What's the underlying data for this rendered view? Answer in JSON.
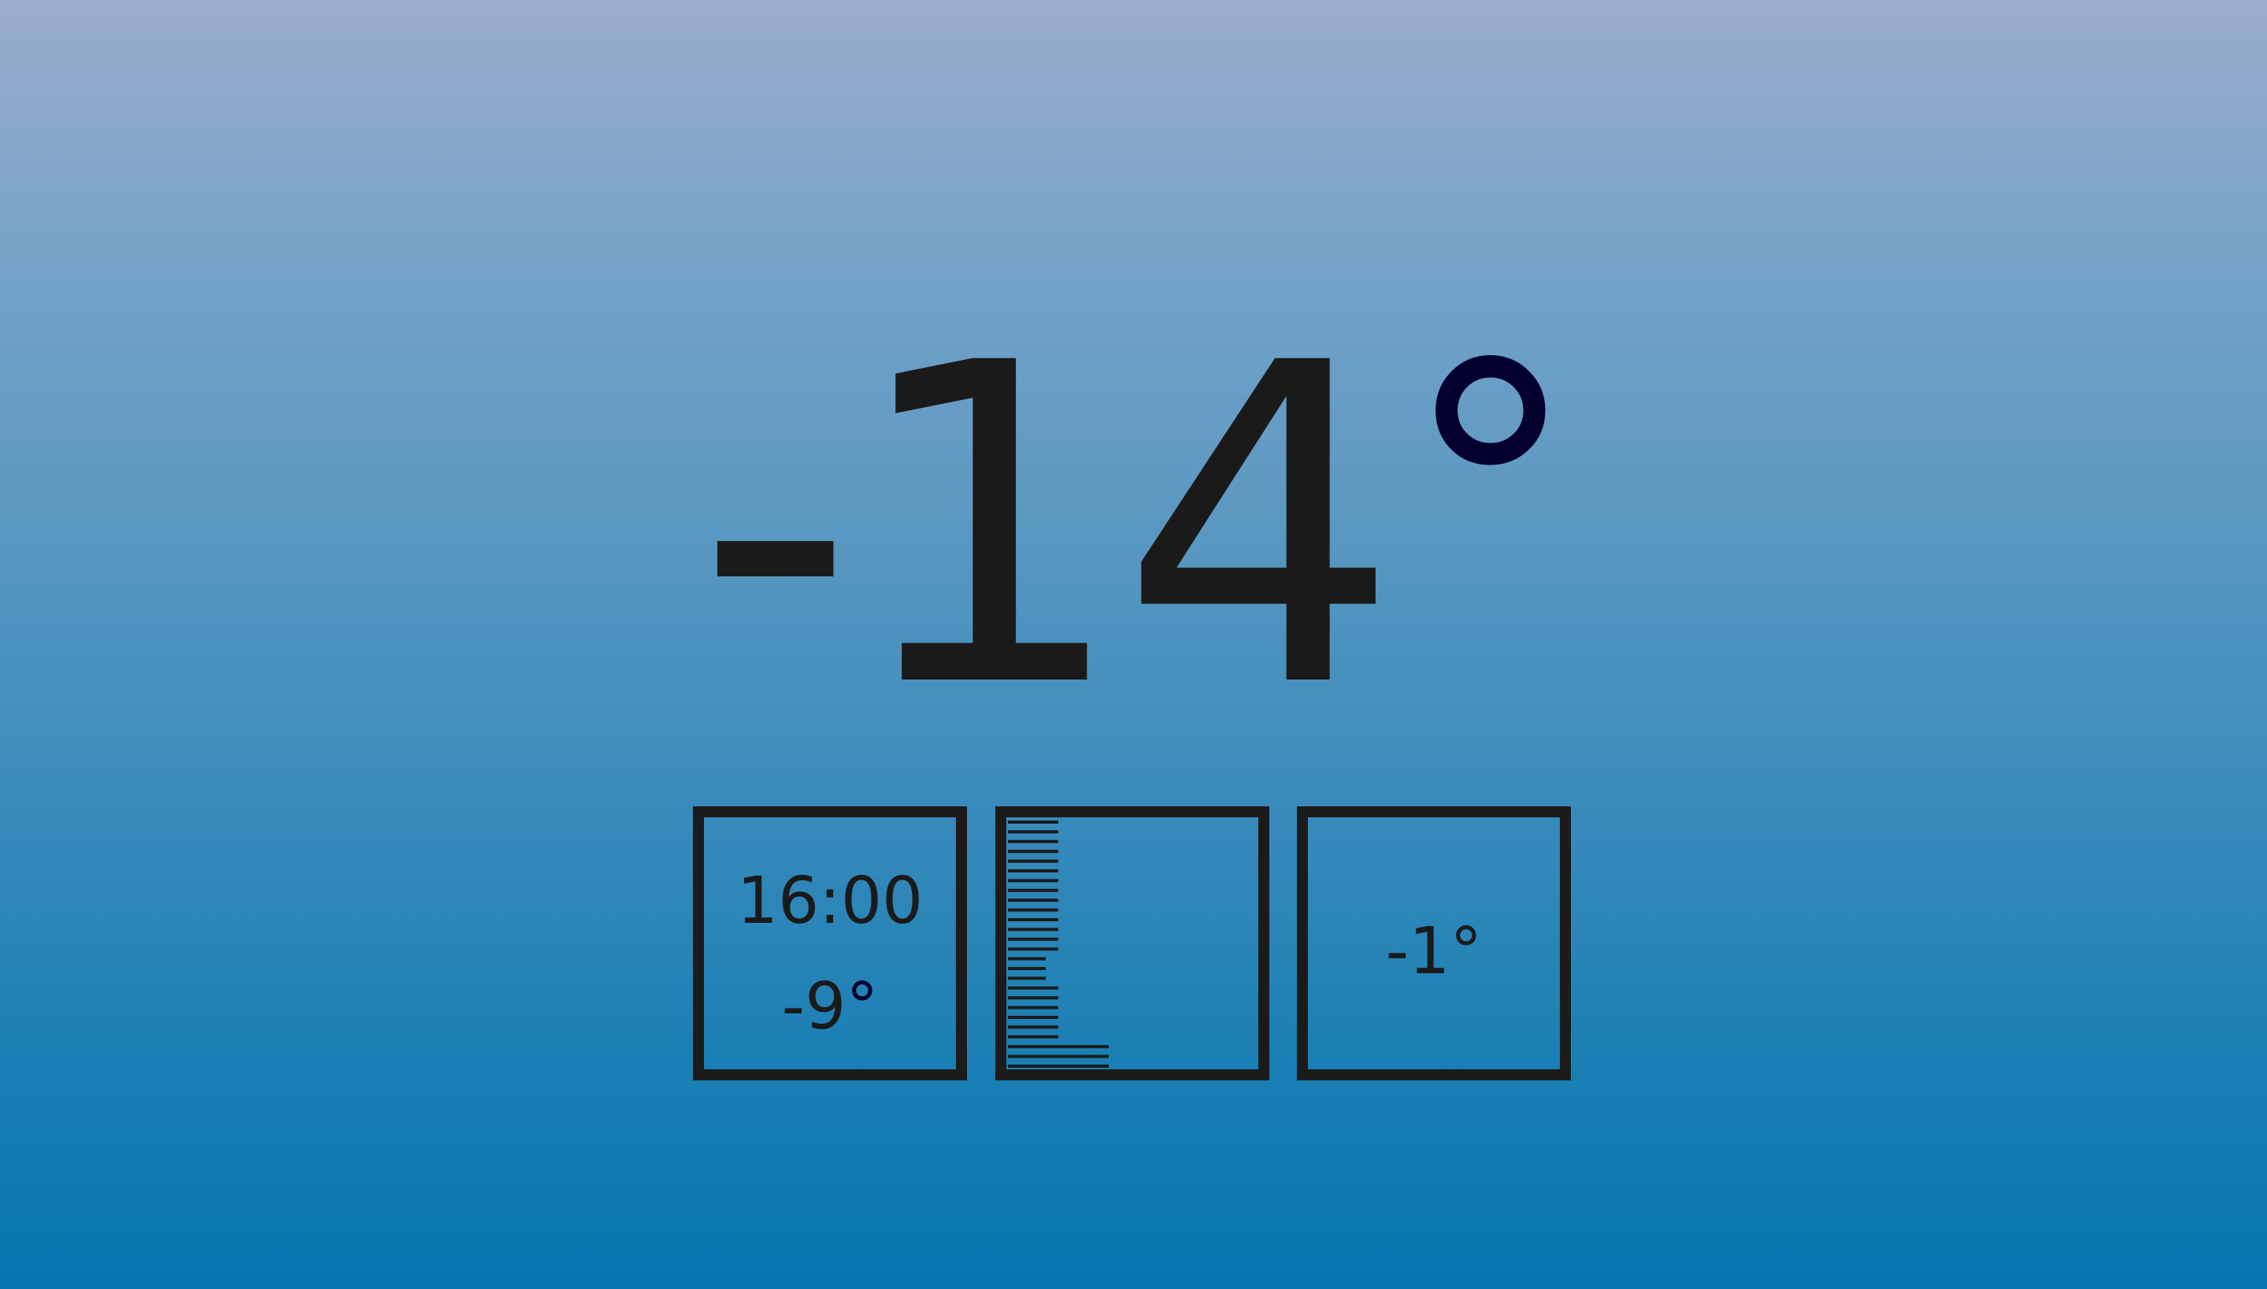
{
  "current": {
    "temperature": "-14",
    "degree_symbol": "°"
  },
  "hourly": {
    "time": "16:00",
    "temperature": "-9",
    "degree_symbol": "°"
  },
  "low": {
    "temperature": "-1",
    "degree_symbol": "°"
  },
  "chart_data": {
    "type": "bar",
    "orientation": "horizontal",
    "values": [
      4,
      4,
      4,
      4,
      4,
      4,
      4,
      4,
      4,
      4,
      4,
      4,
      4,
      4,
      3,
      3,
      3,
      4,
      4,
      4,
      4,
      4,
      4,
      8,
      8,
      8
    ],
    "xlim": [
      0,
      8
    ]
  },
  "colors": {
    "background_top": "#9aaccd",
    "background_bottom": "#0676ae",
    "text": "#1a1a1a",
    "degree_symbol": "#03002e",
    "tile_border": "#1b1b1b"
  }
}
